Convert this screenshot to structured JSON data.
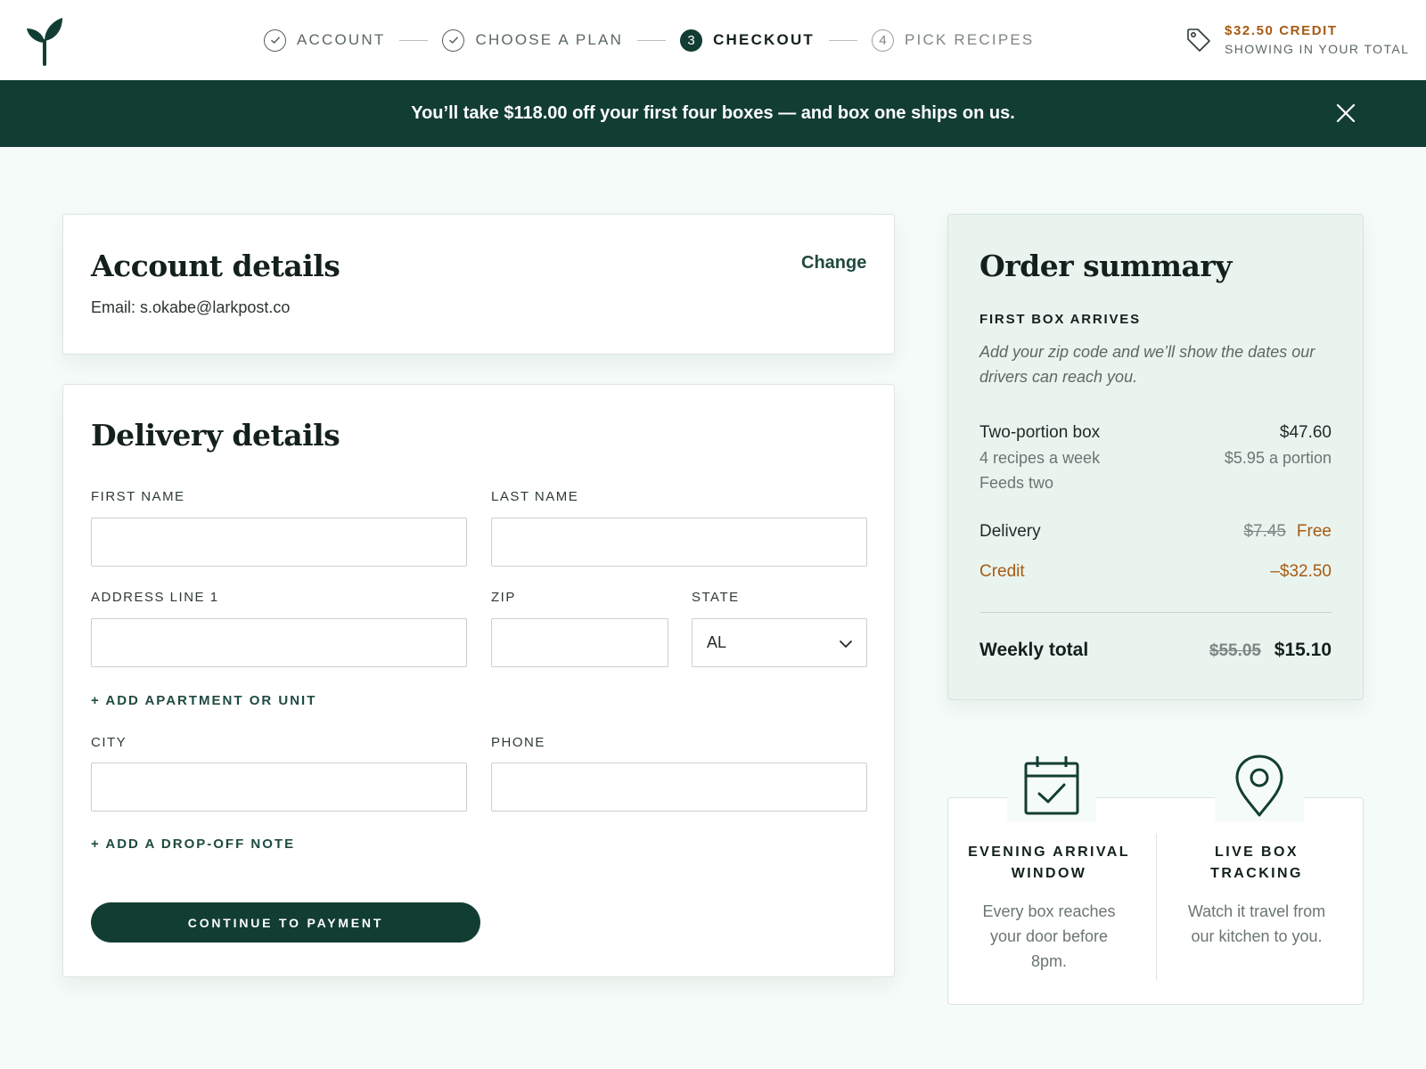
{
  "colors": {
    "brand_green": "#123d33",
    "accent_orange": "#a65a12",
    "page_bg": "#f5fbf8",
    "summary_bg": "#eaf4ef"
  },
  "header": {
    "logo_icon": "sprout-logo-icon",
    "steps": [
      {
        "number": "1",
        "label": "ACCOUNT",
        "state": "done"
      },
      {
        "number": "2",
        "label": "CHOOSE A PLAN",
        "state": "done"
      },
      {
        "number": "3",
        "label": "CHECKOUT",
        "state": "active"
      },
      {
        "number": "4",
        "label": "PICK RECIPES",
        "state": "future"
      }
    ],
    "credit": {
      "icon": "price-tag-icon",
      "amount": "$32.50 CREDIT",
      "subtitle": "SHOWING IN YOUR TOTAL"
    }
  },
  "banner": {
    "text": "You’ll take $118.00 off your first four boxes — and box one ships on us.",
    "close_icon": "close-icon"
  },
  "account": {
    "title": "Account details",
    "change_label": "Change",
    "email_line": "Email: s.okabe@larkpost.co"
  },
  "delivery": {
    "title": "Delivery details",
    "first_name_label": "FIRST NAME",
    "first_name_value": "",
    "last_name_label": "LAST NAME",
    "last_name_value": "",
    "address_label": "ADDRESS LINE 1",
    "address_value": "",
    "zip_label": "ZIP",
    "zip_value": "",
    "state_label": "STATE",
    "state_value": "AL",
    "add_apartment": "+ ADD APARTMENT OR UNIT",
    "city_label": "CITY",
    "city_value": "",
    "phone_label": "PHONE",
    "phone_value": "",
    "add_note": "+ ADD A DROP-OFF NOTE",
    "continue_label": "CONTINUE TO PAYMENT"
  },
  "summary": {
    "title": "Order summary",
    "first_box_heading": "FIRST BOX ARRIVES",
    "first_box_note": "Add your zip code and we’ll show the dates our drivers can reach you.",
    "plan_name": "Two-portion box",
    "plan_price": "$47.60",
    "plan_recipes": "4 recipes a week",
    "plan_portion_price": "$5.95 a portion",
    "plan_feeds": "Feeds two",
    "delivery_label": "Delivery",
    "delivery_old": "$7.45",
    "delivery_new": "Free",
    "credit_label": "Credit",
    "credit_value": "–$32.50",
    "total_label": "Weekly total",
    "total_old": "$55.05",
    "total_new": "$15.10"
  },
  "features": [
    {
      "icon": "calendar-check-icon",
      "title_line1": "EVENING ARRIVAL",
      "title_line2": "WINDOW",
      "desc_line1": "Every box reaches",
      "desc_line2": "your door before",
      "desc_line3": "8pm."
    },
    {
      "icon": "location-pin-icon",
      "title_line1": "LIVE BOX",
      "title_line2": "TRACKING",
      "desc_line1": "Watch it travel from",
      "desc_line2": "our kitchen to you."
    }
  ]
}
